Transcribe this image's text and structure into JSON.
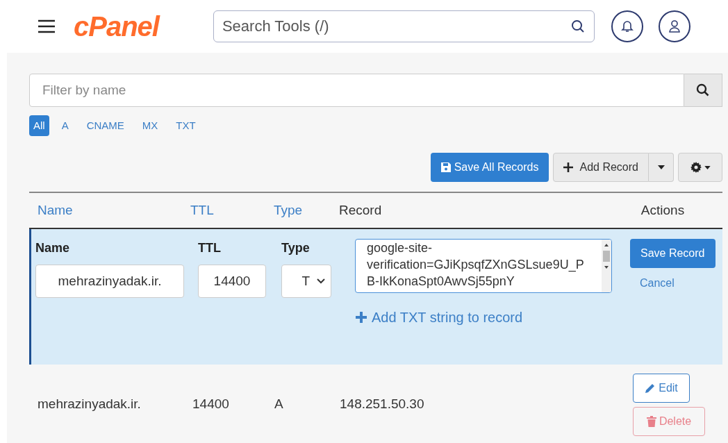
{
  "header": {
    "logo": "cPanel",
    "search": {
      "placeholder": "Search Tools (/)"
    }
  },
  "filter": {
    "placeholder": "Filter by name"
  },
  "type_filters": [
    {
      "label": "All",
      "selected": true
    },
    {
      "label": "A",
      "selected": false
    },
    {
      "label": "CNAME",
      "selected": false
    },
    {
      "label": "MX",
      "selected": false
    },
    {
      "label": "TXT",
      "selected": false
    }
  ],
  "toolbar": {
    "save_all": "Save All Records",
    "add_record": "Add Record"
  },
  "table": {
    "columns": [
      {
        "label": "Name",
        "sortable": true
      },
      {
        "label": "TTL",
        "sortable": true
      },
      {
        "label": "Type",
        "sortable": true
      },
      {
        "label": "Record",
        "sortable": false
      },
      {
        "label": "Actions",
        "sortable": false
      }
    ],
    "edit_row": {
      "name_label": "Name",
      "name_value": "mehrazinyadak.ir.",
      "ttl_label": "TTL",
      "ttl_value": "14400",
      "type_label": "Type",
      "type_value": "T",
      "record_value": "google-site-verification=GJiKpsqfZXnGSLsue9U_PB-IkKonaSpt0AwvSj55pnY",
      "add_string": "Add TXT string to record",
      "save": "Save Record",
      "cancel": "Cancel"
    },
    "rows": [
      {
        "name": "mehrazinyadak.ir.",
        "ttl": "14400",
        "type": "A",
        "record": "148.251.50.30",
        "edit": "Edit",
        "delete": "Delete"
      }
    ]
  }
}
